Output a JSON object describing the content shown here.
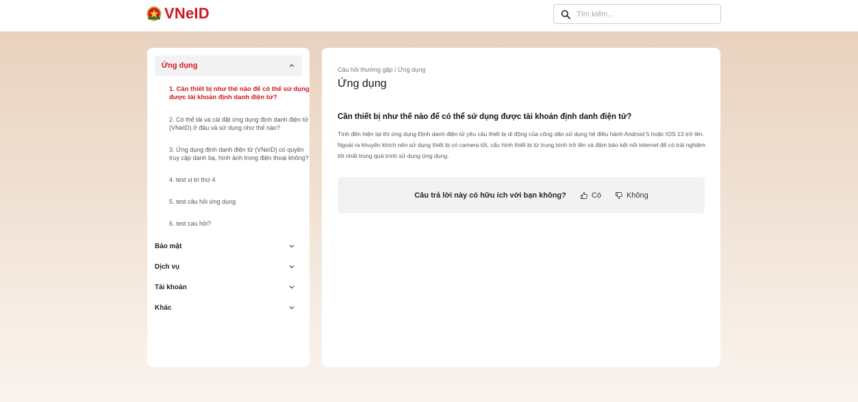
{
  "header": {
    "logo_text": "VNeID",
    "search_placeholder": "Tìm kiếm..."
  },
  "sidebar": {
    "active_category": "Ứng dụng",
    "questions": [
      "1. Cần thiết bị như thế nào để có thể sử dụng được tài khoản định danh điện tử?",
      "2. Có thể tải và cài đặt ứng dụng định danh điện tử (VNeID) ở đâu và sử dụng như thế nào?",
      "3. Ứng dụng định danh điện tử (VNeID) có quyền truy cập danh bạ, hình ảnh trong điện thoại không?",
      "4. test vị trí thứ 4",
      "5. test câu hỏi ứng dụng",
      "6. test cau hỏi?"
    ],
    "categories": [
      "Bảo mật",
      "Dịch vụ",
      "Tài khoản",
      "Khác"
    ]
  },
  "main": {
    "breadcrumb": "Câu hỏi thường gặp / Ứng dụng",
    "title": "Ứng dụng",
    "question": "Cần thiết bị như thế nào để có thể sử dụng được tài khoản định danh điện tử?",
    "answer": "Tính đến hiện tại thì ứng dụng Định danh điện tử yêu cầu thiết bị di động của công dân sử dụng hệ điều hành Android 5 hoặc IOS 13 trở lên. Ngoài ra khuyến khích nên sử dụng thiết bị có camera tốt, cấu hình thiết bị từ trung bình trở lên và đảm bảo kết nối internet để có trải nghiệm tốt nhất trong quá trình sử dụng ứng dụng.",
    "feedback_question": "Câu trả lời này có hữu ích với bạn không?",
    "yes_label": "Có",
    "no_label": "Không"
  },
  "colors": {
    "brand_red": "#d0161f",
    "background_top": "#e9d2bf",
    "panel": "#ffffff"
  },
  "icons": {
    "logo": "vneid-emblem-icon",
    "search": "search-icon",
    "expand": "chevron-down-icon",
    "collapse": "chevron-up-icon",
    "yes": "thumbs-up-icon",
    "no": "thumbs-down-icon"
  }
}
